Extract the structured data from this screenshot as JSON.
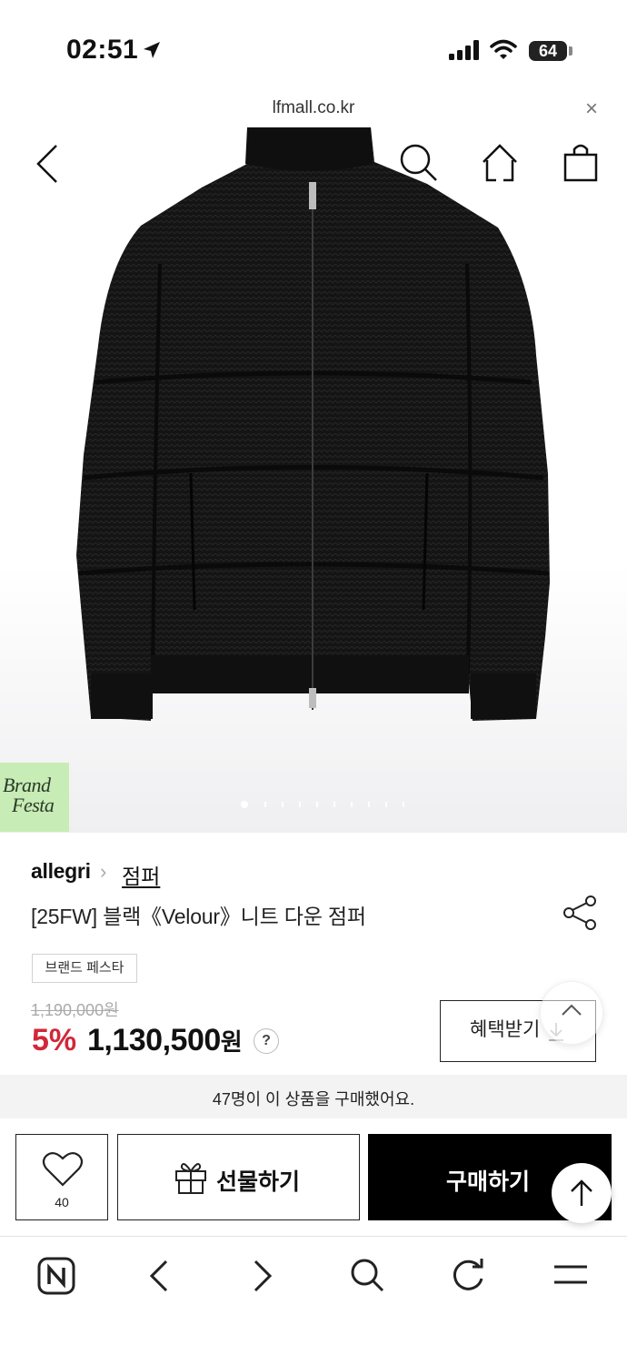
{
  "status_bar": {
    "time": "02:51",
    "battery": "64"
  },
  "browser": {
    "url": "lfmall.co.kr",
    "close_glyph": "×"
  },
  "hero": {
    "badge_line1": "Brand",
    "badge_line2": "Festa",
    "carousel_total": 10,
    "carousel_active": 1
  },
  "product": {
    "brand": "allegri",
    "category": "점퍼",
    "title": "[25FW] 블랙《Velour》니트 다운 점퍼",
    "tag": "브랜드 페스타",
    "original_price": "1,190,000원",
    "discount": "5%",
    "sale_price": "1,130,500",
    "currency": "원",
    "help": "?",
    "benefit_button": "혜택받기"
  },
  "purchase_stat": "47명이 이 상품을 구매했어요.",
  "actions": {
    "wish_count": "40",
    "gift": "선물하기",
    "buy": "구매하기"
  },
  "colors": {
    "discount_red": "#d0283a",
    "badge_green": "#c7ecb5",
    "buy_black": "#000000"
  }
}
